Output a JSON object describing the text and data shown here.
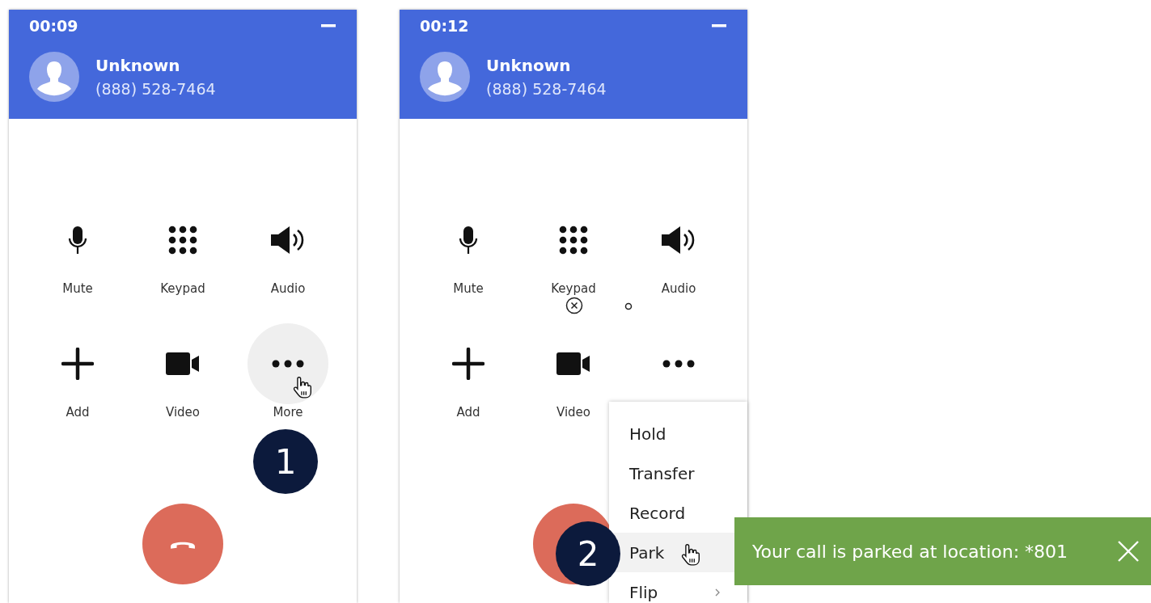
{
  "panels": [
    {
      "timer": "00:09",
      "caller": {
        "name": "Unknown",
        "number": "(888) 528-7464"
      },
      "stray_marks": false,
      "controls": [
        {
          "kind": "mic",
          "label": "Mute",
          "selected": false
        },
        {
          "kind": "keypad",
          "label": "Keypad",
          "selected": false
        },
        {
          "kind": "speaker",
          "label": "Audio",
          "selected": false
        },
        {
          "kind": "plus",
          "label": "Add",
          "selected": false
        },
        {
          "kind": "video",
          "label": "Video",
          "selected": false
        },
        {
          "kind": "more",
          "label": "More",
          "selected": true
        }
      ],
      "handset_shown": true,
      "badge": "1"
    },
    {
      "timer": "00:12",
      "caller": {
        "name": "Unknown",
        "number": "(888) 528-7464"
      },
      "stray_marks": true,
      "controls": [
        {
          "kind": "mic",
          "label": "Mute",
          "selected": false
        },
        {
          "kind": "keypad",
          "label": "Keypad",
          "selected": false
        },
        {
          "kind": "speaker",
          "label": "Audio",
          "selected": false
        },
        {
          "kind": "plus",
          "label": "Add",
          "selected": false
        },
        {
          "kind": "video",
          "label": "Video",
          "selected": false
        },
        {
          "kind": "more",
          "selected": false
        }
      ],
      "menu": [
        {
          "label": "Hold",
          "selected": false,
          "submenu": false
        },
        {
          "label": "Transfer",
          "selected": false,
          "submenu": false
        },
        {
          "label": "Record",
          "selected": false,
          "submenu": false
        },
        {
          "label": "Park",
          "selected": true,
          "submenu": false
        },
        {
          "label": "Flip",
          "selected": false,
          "submenu": true
        }
      ],
      "handset_shown": false,
      "badge": "2"
    }
  ],
  "toast": {
    "text": "Your call is parked at location: *801"
  }
}
